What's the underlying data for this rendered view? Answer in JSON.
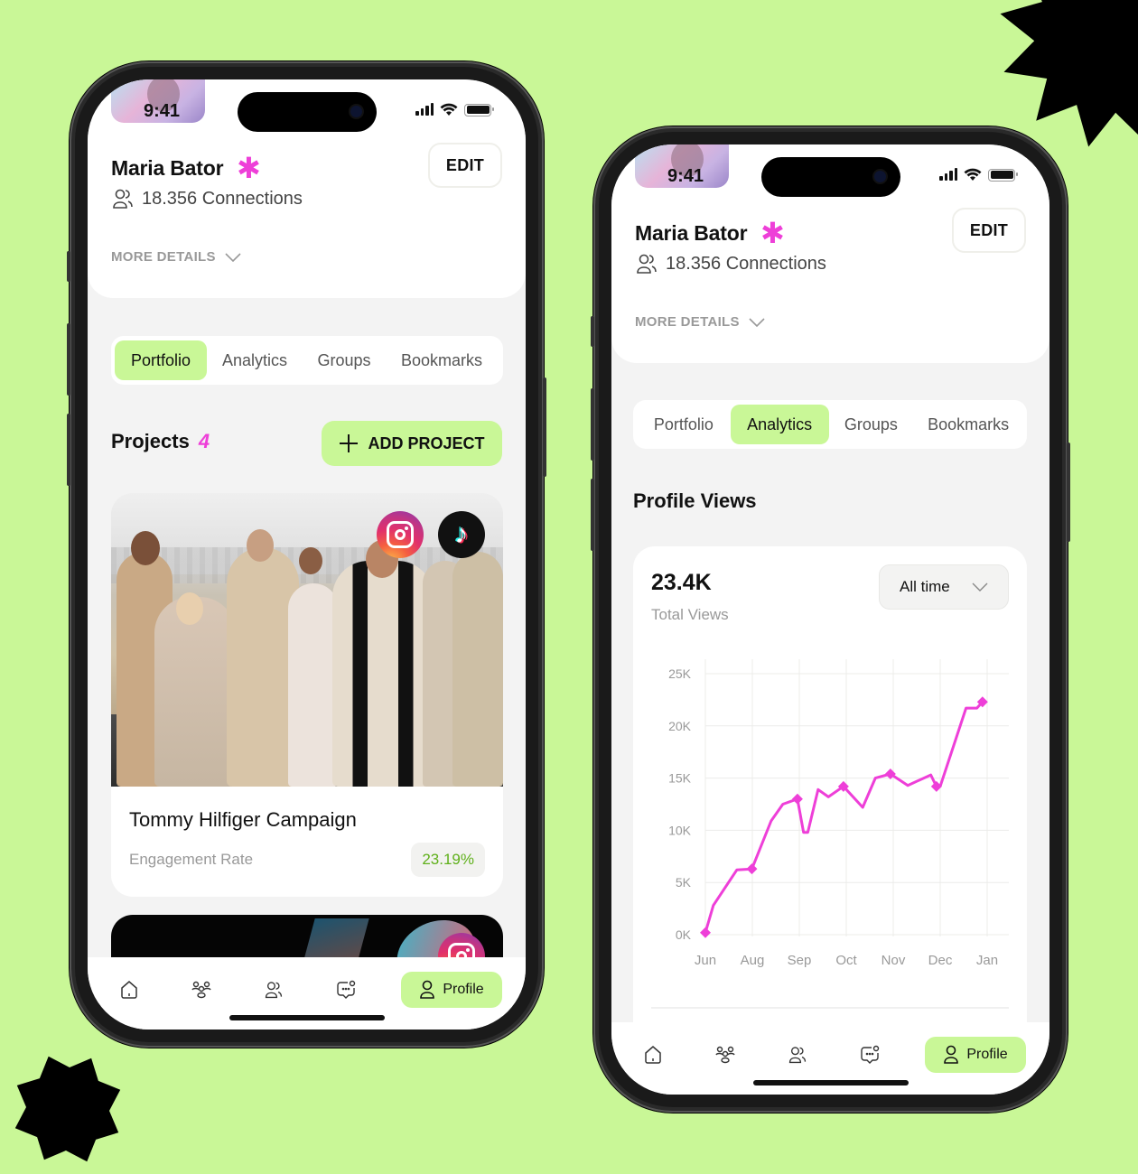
{
  "status_bar": {
    "time": "9:41"
  },
  "profile": {
    "name": "Maria Bator",
    "badge_glyph": "✱",
    "connections": "18.356 Connections",
    "more_details": "MORE DETAILS",
    "edit_label": "EDIT"
  },
  "tabs": [
    {
      "label": "Portfolio"
    },
    {
      "label": "Analytics"
    },
    {
      "label": "Groups"
    },
    {
      "label": "Bookmarks"
    }
  ],
  "phone1": {
    "active_tab": "Portfolio",
    "projects": {
      "title": "Projects",
      "count": "4",
      "add_label": "ADD PROJECT",
      "items": [
        {
          "title": "Tommy Hilfiger Campaign",
          "metric_label": "Engagement Rate",
          "metric_value": "23.19%",
          "platforms": [
            "instagram-icon",
            "tiktok-icon"
          ]
        },
        {
          "title": "",
          "platforms": [
            "instagram-icon"
          ]
        }
      ]
    }
  },
  "phone2": {
    "active_tab": "Analytics",
    "section_title": "Profile Views",
    "total_value": "23.4K",
    "total_label": "Total Views",
    "range_select": "All time"
  },
  "nav": {
    "items": [
      {
        "icon": "home-icon"
      },
      {
        "icon": "community-icon"
      },
      {
        "icon": "people-icon"
      },
      {
        "icon": "chat-icon"
      },
      {
        "icon": "profile-icon",
        "label": "Profile",
        "active": true
      }
    ]
  },
  "colors": {
    "background": "#c9f797",
    "accent": "#c9f797",
    "highlight": "#ee3fd8",
    "positive": "#5fb01a"
  },
  "chart_data": {
    "type": "line",
    "title": "Profile Views",
    "xlabel": "",
    "ylabel": "",
    "x_ticks": [
      "Jun",
      "Aug",
      "Sep",
      "Oct",
      "Nov",
      "Dec",
      "Jan"
    ],
    "y_ticks": [
      "0K",
      "5K",
      "10K",
      "15K",
      "20K",
      "25K"
    ],
    "ylim": [
      0,
      25000
    ],
    "xlim": [
      0,
      6
    ],
    "grid": true,
    "legend": "none",
    "series": [
      {
        "name": "Profile Views",
        "color": "#ee3fd8",
        "points": [
          {
            "x": 0.0,
            "y": 200,
            "marker": true
          },
          {
            "x": 0.17,
            "y": 2800
          },
          {
            "x": 0.67,
            "y": 6200
          },
          {
            "x": 0.99,
            "y": 6300,
            "marker": true
          },
          {
            "x": 1.4,
            "y": 10900
          },
          {
            "x": 1.65,
            "y": 12500
          },
          {
            "x": 1.96,
            "y": 13000,
            "marker": true
          },
          {
            "x": 2.09,
            "y": 9800
          },
          {
            "x": 2.18,
            "y": 9800
          },
          {
            "x": 2.4,
            "y": 13900
          },
          {
            "x": 2.62,
            "y": 13200
          },
          {
            "x": 2.94,
            "y": 14200,
            "marker": true
          },
          {
            "x": 3.35,
            "y": 12200
          },
          {
            "x": 3.62,
            "y": 15000
          },
          {
            "x": 3.94,
            "y": 15400,
            "marker": true
          },
          {
            "x": 4.31,
            "y": 14300
          },
          {
            "x": 4.8,
            "y": 15300
          },
          {
            "x": 4.92,
            "y": 14200,
            "marker": true
          },
          {
            "x": 5.0,
            "y": 14200
          },
          {
            "x": 5.55,
            "y": 21700
          },
          {
            "x": 5.78,
            "y": 21700
          },
          {
            "x": 5.9,
            "y": 22300,
            "marker": true
          }
        ]
      }
    ]
  }
}
